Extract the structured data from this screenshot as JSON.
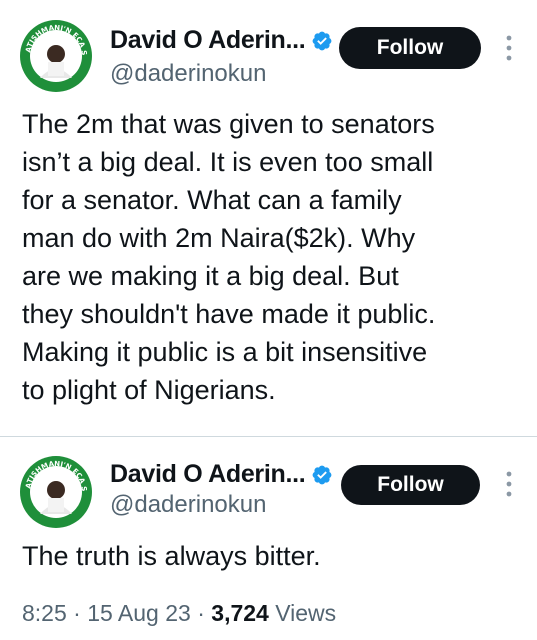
{
  "tweets": [
    {
      "author": {
        "display_name": "David O Aderin...",
        "handle": "@daderinokun",
        "avatar_badge_text": "ATISHMANI'N ECA SPACE"
      },
      "follow_label": "Follow",
      "text": "The 2m that was given to senators\nisn’t a big deal. It is even too small\nfor a senator. What can a family\nman do with 2m Naira($2k). Why\nare we making it a big deal. But\nthey shouldn't have made it public.\nMaking it public is a bit insensitive\nto plight of Nigerians."
    },
    {
      "author": {
        "display_name": "David O Aderin...",
        "handle": "@daderinokun",
        "avatar_badge_text": "ATISHMANI'N ECA SPACE"
      },
      "follow_label": "Follow",
      "text": "The truth is always bitter.",
      "meta": {
        "time": "8:25",
        "separator": "·",
        "date": "15 Aug 23",
        "views_count": "3,724",
        "views_label": "Views"
      }
    }
  ],
  "colors": {
    "verified": "#1d9bf0",
    "follow_bg": "#0f1419",
    "secondary_text": "#536471",
    "avatar_ring": "#1f8f3a"
  },
  "icons": {
    "verified": "verified-badge-icon",
    "more": "more-vertical-icon"
  }
}
